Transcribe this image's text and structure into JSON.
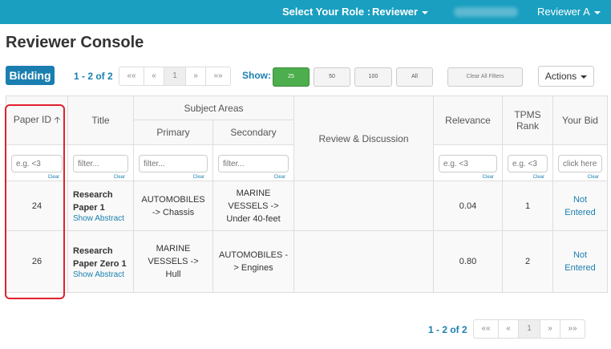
{
  "topbar": {
    "role_label": "Select Your Role :",
    "role_value": "Reviewer",
    "user_name": "Reviewer A"
  },
  "page_title": "Reviewer Console",
  "tab": "Bidding",
  "pager_top": {
    "info": "1 - 2 of 2",
    "buttons": [
      "««",
      "«",
      "1",
      "»",
      "»»"
    ]
  },
  "show": {
    "label": "Show:",
    "sizes": [
      "25",
      "50",
      "100",
      "All"
    ],
    "selected": "25"
  },
  "clear_all": "Clear All Filters",
  "actions": "Actions",
  "table": {
    "headers": {
      "paper_id": "Paper ID",
      "title": "Title",
      "subject_areas": "Subject Areas",
      "primary": "Primary",
      "secondary": "Secondary",
      "review": "Review & Discussion",
      "relevance": "Relevance",
      "tpms": "TPMS Rank",
      "bid": "Your Bid"
    },
    "filters": {
      "paper_id": "e.g. <3",
      "title": "filter...",
      "primary": "filter...",
      "secondary": "filter...",
      "relevance": "e.g. <3",
      "tpms": "e.g. <3",
      "bid": "click here",
      "clear": "Clear"
    },
    "rows": [
      {
        "id": "24",
        "title": "Research Paper 1",
        "abstract": "Show Abstract",
        "primary": "AUTOMOBILES -> Chassis",
        "secondary": "MARINE VESSELS -> Under 40-feet",
        "review": "",
        "relevance": "0.04",
        "tpms": "1",
        "bid": "Not Entered"
      },
      {
        "id": "26",
        "title": "Research Paper Zero 1",
        "abstract": "Show Abstract",
        "primary": "MARINE VESSELS -> Hull",
        "secondary": "AUTOMOBILES -> Engines",
        "review": "",
        "relevance": "0.80",
        "tpms": "2",
        "bid": "Not Entered"
      }
    ]
  },
  "pager_bottom": {
    "info": "1 - 2 of 2",
    "buttons": [
      "««",
      "«",
      "1",
      "»",
      "»»"
    ]
  }
}
